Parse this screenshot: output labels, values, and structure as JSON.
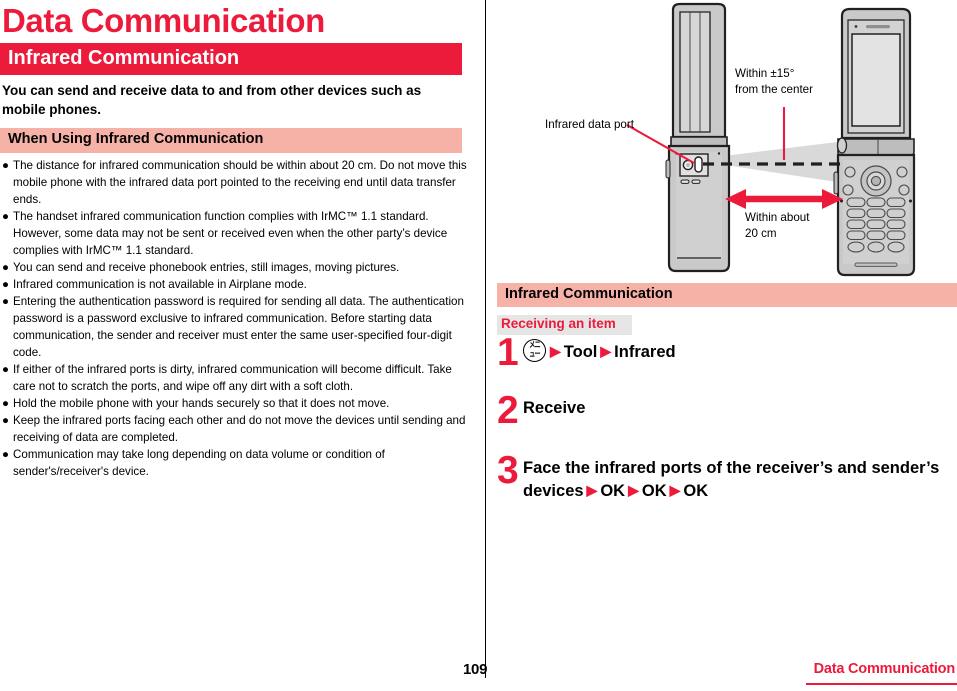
{
  "document": {
    "title": "Data Communication",
    "page_number": "109",
    "footer_label": "Data Communication"
  },
  "colors": {
    "accent_red": "#ed1b3b",
    "band_pink": "#f7b2a8",
    "subhead_gray": "#e6e6e6",
    "device_fill": "#c9c9c9",
    "beam_gray": "#d9d9d9"
  },
  "left_column": {
    "red_band_title": "Infrared Communication",
    "lead_text": "You can send and receive data to and from other devices such as mobile phones.",
    "pink_band_title": "When Using Infrared Communication",
    "bullet_marker": "●",
    "notes": [
      "The distance for infrared communication should be within about 20 cm. Do not move this mobile phone with the infrared data port pointed to the receiving end until data transfer ends.",
      "The handset infrared communication function complies with IrMC™ 1.1 standard. However, some data may not be sent or received even when the other party’s device complies with IrMC™ 1.1 standard.",
      "You can send and receive phonebook entries, still images, moving pictures.",
      "Infrared communication is not available in Airplane mode.",
      "Entering the authentication password is required for sending all data. The authentication password is a password exclusive to infrared communication. Before starting data communication, the sender and receiver must enter the same user-specified four-digit code.",
      "If either of the infrared ports is dirty, infrared communication will become difficult. Take care not to scratch the ports, and wipe off any dirt with a soft cloth.",
      "Hold the mobile phone with your hands securely so that it does not move.",
      "Keep the infrared ports facing each other and do not move the devices until sending and receiving of data are completed.",
      "Communication may take long depending on data volume or condition of sender's/receiver's device."
    ]
  },
  "figure": {
    "label_port": "Infrared data port",
    "label_angle_line1": "Within ±15°",
    "label_angle_line2": "from the center",
    "label_distance_line1": "Within about",
    "label_distance_line2": "20 cm"
  },
  "right_column": {
    "pink_band_title": "Infrared Communication",
    "subhead": "Receiving an item",
    "arrow_glyph": "▶",
    "steps": [
      {
        "number": "1",
        "key_icon": "menu-key-icon",
        "key_glyph": "メニュー",
        "parts": [
          "Tool",
          "Infrared"
        ]
      },
      {
        "number": "2",
        "parts": [
          "Receive"
        ]
      },
      {
        "number": "3",
        "parts": [
          "Face the infrared ports of the receiver’s and sender’s devices",
          "OK",
          "OK",
          "OK"
        ]
      }
    ]
  }
}
